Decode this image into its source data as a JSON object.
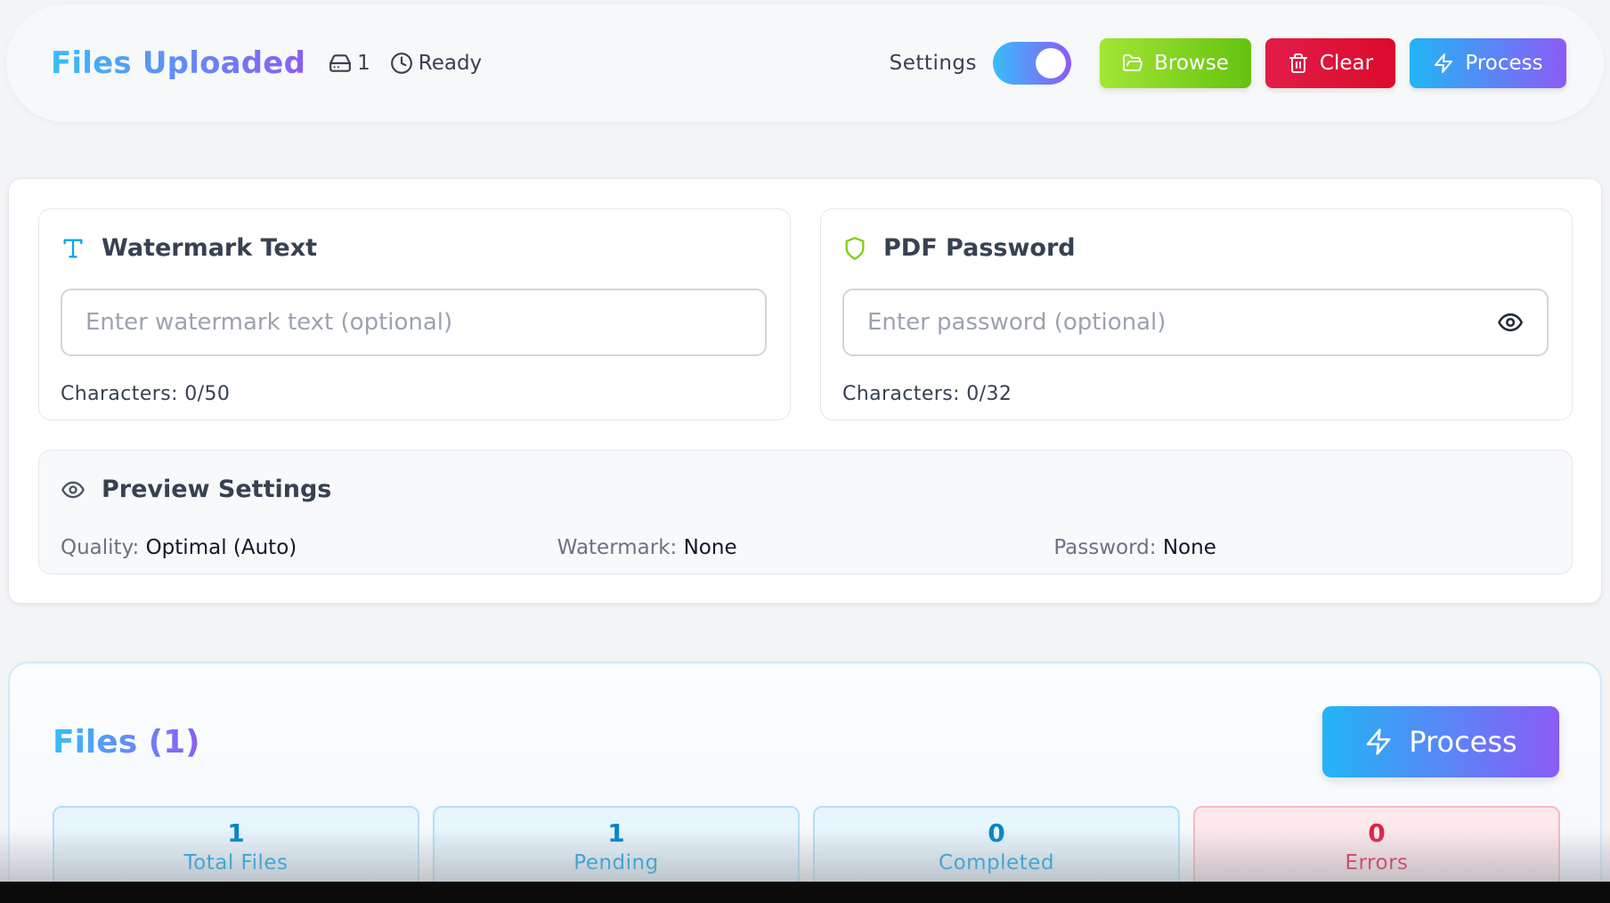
{
  "header": {
    "title": "Files Uploaded",
    "file_count": "1",
    "status": "Ready",
    "settings_label": "Settings",
    "settings_enabled": true,
    "browse_label": "Browse",
    "clear_label": "Clear",
    "process_label": "Process"
  },
  "watermark": {
    "title": "Watermark Text",
    "placeholder": "Enter watermark text (optional)",
    "value": "",
    "chars": "Characters: 0/50"
  },
  "password": {
    "title": "PDF Password",
    "placeholder": "Enter password (optional)",
    "value": "",
    "chars": "Characters: 0/32"
  },
  "preview": {
    "title": "Preview Settings",
    "quality_label": "Quality:",
    "quality_value": "Optimal (Auto)",
    "watermark_label": "Watermark:",
    "watermark_value": "None",
    "password_label": "Password:",
    "password_value": "None"
  },
  "files": {
    "title": "Files (1)",
    "process_label": "Process",
    "stats": [
      {
        "value": "1",
        "label": "Total Files"
      },
      {
        "value": "1",
        "label": "Pending"
      },
      {
        "value": "0",
        "label": "Completed"
      },
      {
        "value": "0",
        "label": "Errors"
      }
    ]
  },
  "icons": {
    "files": "hard-drive-icon",
    "status": "clock-icon",
    "browse": "folder-open-icon",
    "clear": "trash-icon",
    "process": "zap-icon",
    "watermark": "type-icon",
    "password": "shield-icon",
    "reveal": "eye-icon",
    "preview": "eye-icon"
  },
  "colors": {
    "accent_start": "#38bdf8",
    "accent_end": "#8b5cf6",
    "browse": "#84cc16",
    "clear": "#e11d48",
    "error": "#e11d48"
  }
}
